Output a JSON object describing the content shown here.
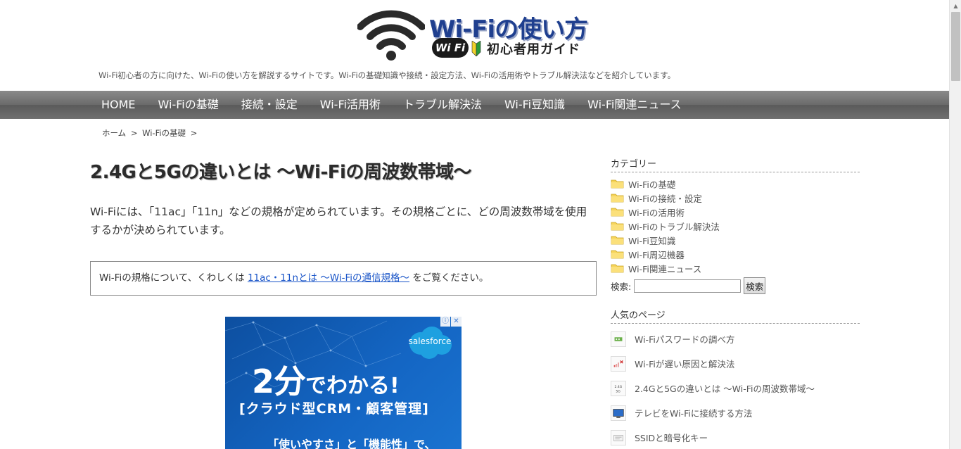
{
  "site": {
    "title": "Wi-Fiの使い方",
    "badge": "Wi Fi",
    "subtitle": "初心者用ガイド",
    "tagline": "Wi-Fi初心者の方に向けた、Wi-Fiの使い方を解説するサイトです。Wi-Fiの基礎知識や接続・設定方法、Wi-Fiの活用術やトラブル解決法などを紹介しています。"
  },
  "nav": {
    "items": [
      "HOME",
      "Wi-Fiの基礎",
      "接続・設定",
      "Wi-Fi活用術",
      "トラブル解決法",
      "Wi-Fi豆知識",
      "Wi-Fi関連ニュース"
    ]
  },
  "breadcrumb": {
    "home": "ホーム",
    "sep": ">",
    "category": "Wi-Fiの基礎"
  },
  "article": {
    "title": "2.4Gと5Gの違いとは ～Wi-Fiの周波数帯域～",
    "intro": "Wi-Fiには、「11ac」「11n」などの規格が定められています。その規格ごとに、どの周波数帯域を使用するかが決められています。",
    "note_prefix": "Wi-Fiの規格について、くわしくは",
    "note_link": "11ac・11nとは ～Wi-Fiの通信規格～",
    "note_suffix": "をご覧ください。"
  },
  "ad": {
    "info": "ⓘ",
    "close": "✕",
    "brand": "salesforce",
    "headline_big": "2分",
    "headline_small": "でわかる!",
    "sub": "[クラウド型CRM・顧客管理]",
    "sub2": "「使いやすさ」と「機能性」で、"
  },
  "sidebar": {
    "categories_heading": "カテゴリー",
    "categories": [
      "Wi-Fiの基礎",
      "Wi-Fiの接続・設定",
      "Wi-Fiの活用術",
      "Wi-Fiのトラブル解決法",
      "Wi-Fi豆知識",
      "Wi-Fi周辺機器",
      "Wi-Fi関連ニュース"
    ],
    "search_label": "検索:",
    "search_value": "",
    "search_button": "検索",
    "popular_heading": "人気のページ",
    "popular": [
      "Wi-Fiパスワードの調べ方",
      "Wi-Fiが遅い原因と解決法",
      "2.4Gと5Gの違いとは ～Wi-Fiの周波数帯域～",
      "テレビをWi-Fiに接続する方法",
      "SSIDと暗号化キー"
    ]
  },
  "colors": {
    "nav_bg": "#6f6f6f",
    "link": "#1a55c8",
    "logo_blue": "#1f3f8f",
    "ad_blue": "#1466c4"
  }
}
